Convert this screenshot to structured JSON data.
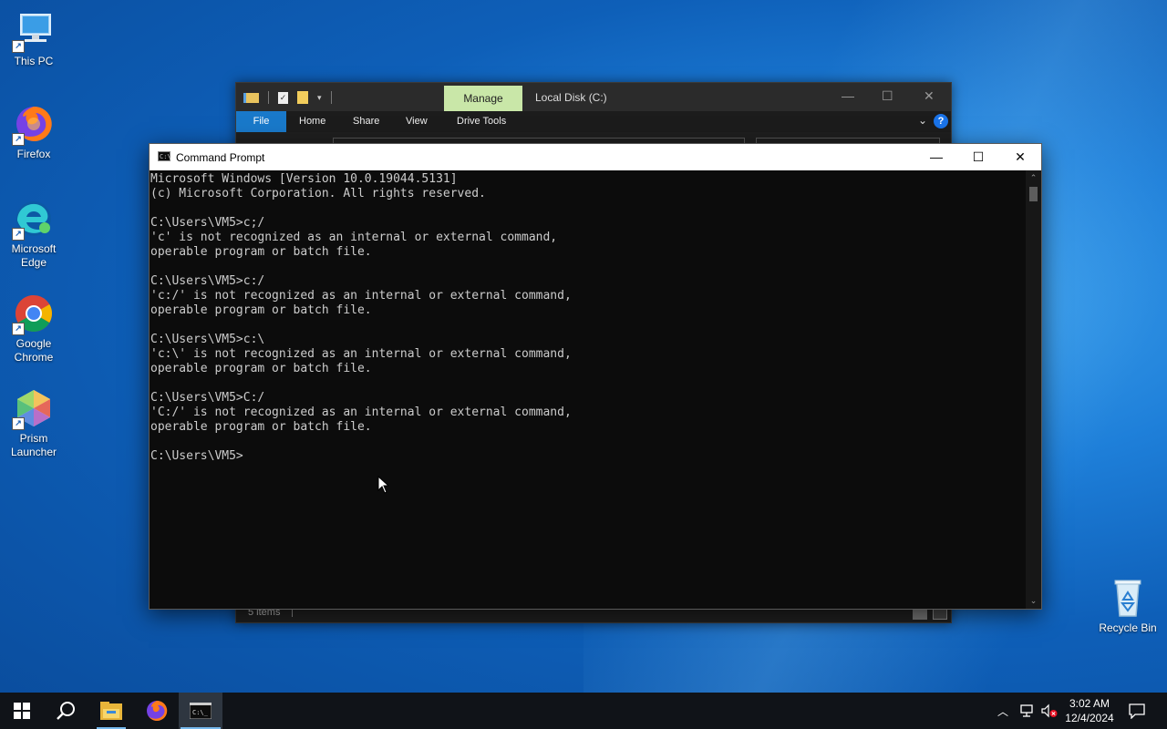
{
  "desktop": {
    "icons": [
      {
        "label": "This PC"
      },
      {
        "label": "Firefox"
      },
      {
        "label": "Microsoft Edge"
      },
      {
        "label": "Google Chrome"
      },
      {
        "label": "Prism Launcher"
      },
      {
        "label": "Recycle Bin"
      }
    ]
  },
  "explorer": {
    "manage_tab": "Manage",
    "title": "Local Disk (C:)",
    "ribbon_tabs": [
      "File",
      "Home",
      "Share",
      "View",
      "Drive Tools"
    ],
    "help": "?",
    "status_count": "5 items"
  },
  "cmd": {
    "title": "Command Prompt",
    "output": "Microsoft Windows [Version 10.0.19044.5131]\n(c) Microsoft Corporation. All rights reserved.\n\nC:\\Users\\VM5>c;/\n'c' is not recognized as an internal or external command,\noperable program or batch file.\n\nC:\\Users\\VM5>c:/\n'c:/' is not recognized as an internal or external command,\noperable program or batch file.\n\nC:\\Users\\VM5>c:\\\n'c:\\' is not recognized as an internal or external command,\noperable program or batch file.\n\nC:\\Users\\VM5>C:/\n'C:/' is not recognized as an internal or external command,\noperable program or batch file.\n\nC:\\Users\\VM5>"
  },
  "taskbar": {
    "time": "3:02 AM",
    "date": "12/4/2024"
  },
  "colors": {
    "manage_tab": "#c9e7a8",
    "file_tab": "#1979ca",
    "taskbar": "#101318",
    "cmd_bg": "#0c0c0c",
    "cmd_text": "#cccccc",
    "accent": "#76b9ed"
  }
}
